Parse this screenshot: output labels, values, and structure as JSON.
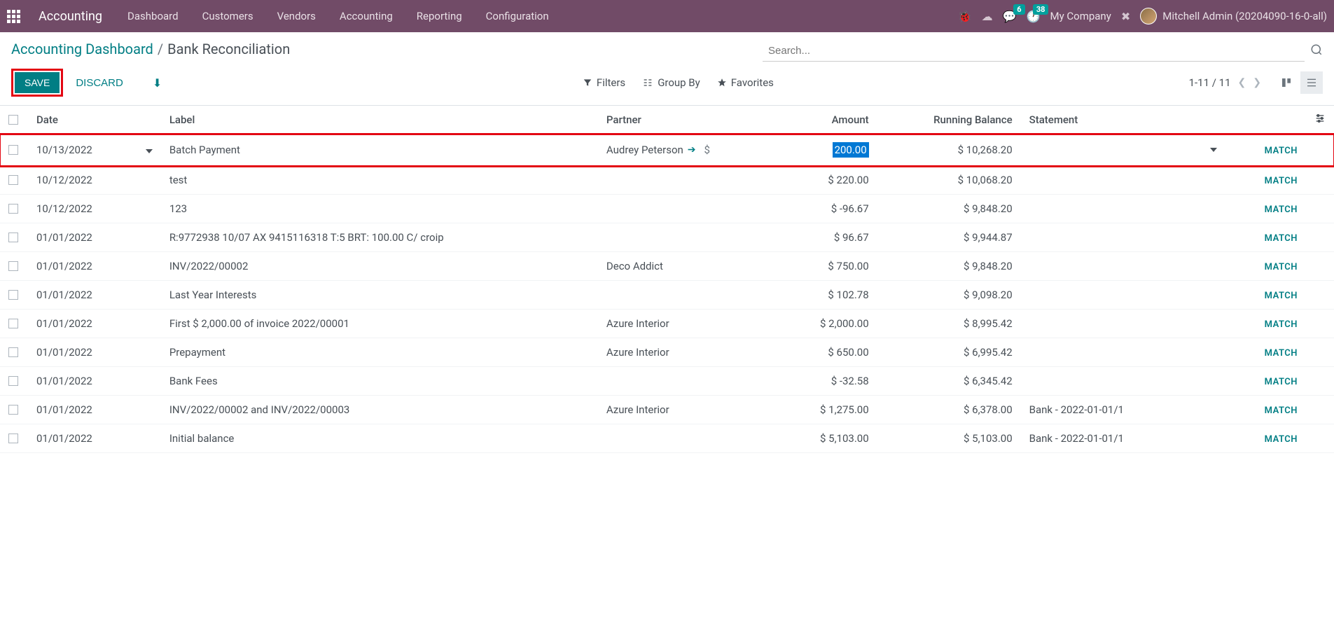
{
  "navbar": {
    "app_name": "Accounting",
    "menu": [
      "Dashboard",
      "Customers",
      "Vendors",
      "Accounting",
      "Reporting",
      "Configuration"
    ],
    "messages_badge": "6",
    "activities_badge": "38",
    "company": "My Company",
    "user": "Mitchell Admin (20204090-16-0-all)"
  },
  "breadcrumb": {
    "parent": "Accounting Dashboard",
    "current": "Bank Reconciliation"
  },
  "buttons": {
    "save": "SAVE",
    "discard": "DISCARD"
  },
  "search": {
    "placeholder": "Search...",
    "filters": "Filters",
    "groupby": "Group By",
    "favorites": "Favorites"
  },
  "pager": {
    "range": "1-11 / 11"
  },
  "columns": {
    "date": "Date",
    "label": "Label",
    "partner": "Partner",
    "amount": "Amount",
    "running_balance": "Running Balance",
    "statement": "Statement"
  },
  "rows": [
    {
      "date": "10/13/2022",
      "label": "Batch Payment",
      "partner": "Audrey Peterson",
      "amount": "200.00",
      "running": "$ 10,268.20",
      "statement": "",
      "match": "MATCH",
      "editing": true
    },
    {
      "date": "10/12/2022",
      "label": "test",
      "partner": "",
      "amount": "$ 220.00",
      "running": "$ 10,068.20",
      "statement": "",
      "match": "MATCH"
    },
    {
      "date": "10/12/2022",
      "label": "123",
      "partner": "",
      "amount": "$ -96.67",
      "running": "$ 9,848.20",
      "statement": "",
      "match": "MATCH"
    },
    {
      "date": "01/01/2022",
      "label": "R:9772938 10/07 AX 9415116318 T:5 BRT: 100.00 C/ croip",
      "partner": "",
      "amount": "$ 96.67",
      "running": "$ 9,944.87",
      "statement": "",
      "match": "MATCH"
    },
    {
      "date": "01/01/2022",
      "label": "INV/2022/00002",
      "partner": "Deco Addict",
      "amount": "$ 750.00",
      "running": "$ 9,848.20",
      "statement": "",
      "match": "MATCH"
    },
    {
      "date": "01/01/2022",
      "label": "Last Year Interests",
      "partner": "",
      "amount": "$ 102.78",
      "running": "$ 9,098.20",
      "statement": "",
      "match": "MATCH"
    },
    {
      "date": "01/01/2022",
      "label": "First $ 2,000.00 of invoice 2022/00001",
      "partner": "Azure Interior",
      "amount": "$ 2,000.00",
      "running": "$ 8,995.42",
      "statement": "",
      "match": "MATCH"
    },
    {
      "date": "01/01/2022",
      "label": "Prepayment",
      "partner": "Azure Interior",
      "amount": "$ 650.00",
      "running": "$ 6,995.42",
      "statement": "",
      "match": "MATCH"
    },
    {
      "date": "01/01/2022",
      "label": "Bank Fees",
      "partner": "",
      "amount": "$ -32.58",
      "running": "$ 6,345.42",
      "statement": "",
      "match": "MATCH"
    },
    {
      "date": "01/01/2022",
      "label": "INV/2022/00002 and INV/2022/00003",
      "partner": "Azure Interior",
      "amount": "$ 1,275.00",
      "running": "$ 6,378.00",
      "statement": "Bank - 2022-01-01/1",
      "match": "MATCH"
    },
    {
      "date": "01/01/2022",
      "label": "Initial balance",
      "partner": "",
      "amount": "$ 5,103.00",
      "running": "$ 5,103.00",
      "statement": "Bank - 2022-01-01/1",
      "match": "MATCH"
    }
  ]
}
